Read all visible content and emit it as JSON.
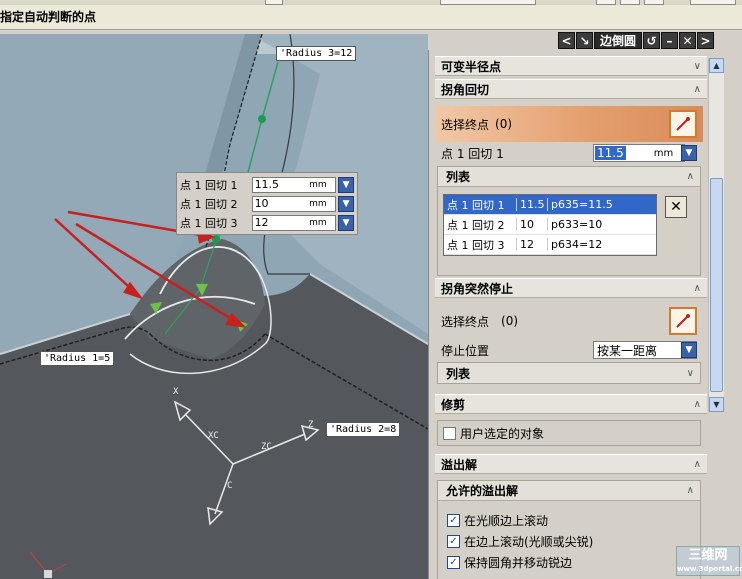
{
  "status_bar": {
    "prompt": "指定自动判断的点"
  },
  "dialog": {
    "title": "边倒圆"
  },
  "viewport": {
    "labels": {
      "radius_3": "'Radius 3=12",
      "radius_1": "'Radius 1=5",
      "radius_2": "'Radius 2=8"
    },
    "axis": {
      "x": "X",
      "xc": "XC",
      "z": "Z",
      "zc": "ZC",
      "c": "C"
    },
    "inline_edit": [
      {
        "label": "点 1 回切 1",
        "value": "11.5",
        "unit": "mm"
      },
      {
        "label": "点 1 回切 2",
        "value": "10",
        "unit": "mm"
      },
      {
        "label": "点 1 回切 3",
        "value": "12",
        "unit": "mm"
      }
    ]
  },
  "panel": {
    "variable_radius": {
      "title": "可变半径点"
    },
    "corner_setback": {
      "title": "拐角回切",
      "select_end": {
        "label": "选择终点",
        "count": "(0)"
      },
      "setback_field": {
        "label": "点 1 回切 1",
        "value": "11.5",
        "unit": "mm"
      },
      "list": {
        "title": "列表",
        "rows": [
          {
            "name": "点 1 回切 1",
            "value": "11.5",
            "expr": "p635=11.5"
          },
          {
            "name": "点 1 回切 2",
            "value": "10",
            "expr": "p633=10"
          },
          {
            "name": "点 1 回切 3",
            "value": "12",
            "expr": "p634=12"
          }
        ]
      }
    },
    "stop_short": {
      "title": "拐角突然停止",
      "select_end": {
        "label": "选择终点",
        "count": "(0)"
      },
      "stop_position": {
        "label": "停止位置",
        "value": "按某一距离"
      },
      "list": {
        "title": "列表"
      }
    },
    "trim": {
      "title": "修剪",
      "user_selected": {
        "label": "用户选定的对象",
        "checked": false
      }
    },
    "overflow": {
      "title": "溢出解",
      "allowed": {
        "title": "允许的溢出解",
        "options": [
          {
            "label": "在光顺边上滚动",
            "checked": true
          },
          {
            "label": "在边上滚动(光顺或尖锐)",
            "checked": true
          },
          {
            "label": "保持圆角并移动锐边",
            "checked": true
          }
        ]
      }
    }
  },
  "watermark": {
    "text": "三维网",
    "sub": "www.3dportal.cn"
  },
  "colors": {
    "selection": "#3167c8",
    "accent": "#d88c5a",
    "viewport_bg": "#8fa6b4"
  }
}
